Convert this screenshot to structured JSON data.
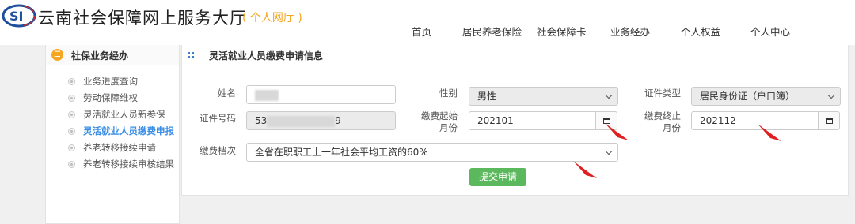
{
  "header": {
    "logo_text": "SI",
    "title": "云南社会保障网上服务大厅",
    "subtitle": "( 个人网厅 )",
    "nav": [
      "首页",
      "居民养老保险",
      "社会保障卡",
      "业务经办",
      "个人权益",
      "个人中心"
    ]
  },
  "sidebar": {
    "title": "社保业务经办",
    "items": [
      "业务进度查询",
      "劳动保障维权",
      "灵活就业人员新参保",
      "灵活就业人员缴费申报",
      "养老转移接续申请",
      "养老转移接续审核结果"
    ],
    "active_index": 3
  },
  "panel": {
    "title": "灵活就业人员缴费申请信息",
    "name_label": "姓名",
    "gender_label": "性别",
    "gender_value": "男性",
    "idtype_label": "证件类型",
    "idtype_value": "居民身份证（户口簿）",
    "idno_label": "证件号码",
    "idno_prefix": "53",
    "idno_suffix": "9",
    "start_label": "缴费起始月份",
    "start_value": "202101",
    "end_label": "缴费终止月份",
    "end_value": "202112",
    "grade_label": "缴费档次",
    "grade_value": "全省在职职工上一年社会平均工资的60%",
    "submit_label": "提交申请"
  },
  "colors": {
    "accent": "#3a8ee6",
    "submit": "#5cb85c",
    "subtitle": "#f5a623",
    "annotation_arrow": "#e02020"
  }
}
